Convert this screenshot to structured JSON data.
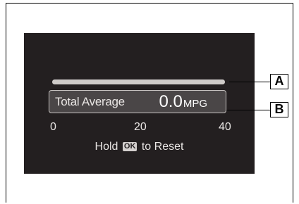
{
  "display": {
    "bar": {
      "fill_fraction": 1.0
    },
    "total_average": {
      "label": "Total Average",
      "value": "0.0",
      "unit": "MPG"
    },
    "scale": {
      "ticks": [
        "0",
        "20",
        "40"
      ]
    },
    "hold_prefix": "Hold",
    "ok_key": "OK",
    "hold_suffix": "to Reset"
  },
  "callouts": {
    "a": "A",
    "b": "B"
  },
  "colors": {
    "display_bg": "#231f20",
    "bar": "#cfcbc9",
    "box_border": "#c8c4c2"
  }
}
